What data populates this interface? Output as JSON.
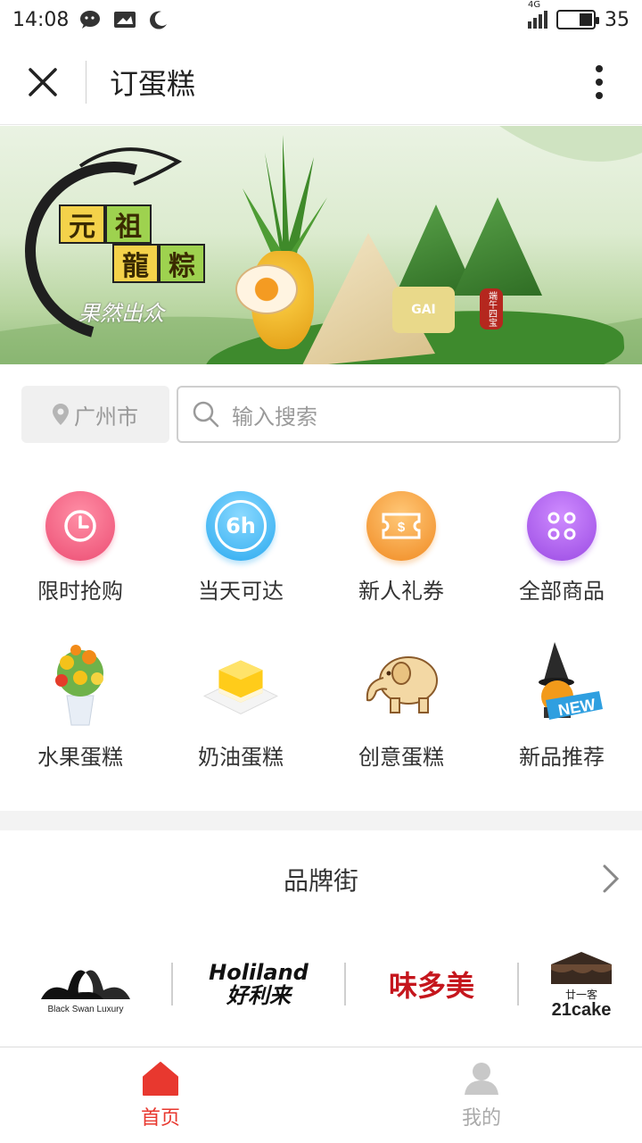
{
  "status_bar": {
    "time": "14:08",
    "network": "4G",
    "battery": "35"
  },
  "title_bar": {
    "title": "订蛋糕"
  },
  "banner": {
    "brand_chars": [
      "元",
      "祖",
      "龍",
      "粽"
    ],
    "slogan": "果然出众",
    "seal_text": "端午四宝",
    "mooncake_text": "GAI"
  },
  "location": {
    "city": "广州市",
    "search_placeholder": "输入搜索"
  },
  "categories": [
    {
      "label": "限时抢购",
      "icon": "clock-icon",
      "color": "#f2587c"
    },
    {
      "label": "当天可达",
      "icon": "6h-icon",
      "color": "#3fb7f3",
      "badge": "6h"
    },
    {
      "label": "新人礼券",
      "icon": "coupon-icon",
      "color": "#f7a03a"
    },
    {
      "label": "全部商品",
      "icon": "grid-dots-icon",
      "color": "#a65ae6"
    },
    {
      "label": "水果蛋糕",
      "icon": "fruit-cake-icon"
    },
    {
      "label": "奶油蛋糕",
      "icon": "cream-cake-icon"
    },
    {
      "label": "创意蛋糕",
      "icon": "elephant-cake-icon"
    },
    {
      "label": "新品推荐",
      "icon": "new-product-icon",
      "badge": "NEW"
    }
  ],
  "brand_street": {
    "title": "品牌街",
    "brands": [
      {
        "name": "Black Swan Luxury"
      },
      {
        "name_en": "Holiland",
        "name_cn": "好利来"
      },
      {
        "name": "味多美"
      },
      {
        "name_cn": "廿一客",
        "name_en": "21cake"
      }
    ]
  },
  "tabs": [
    {
      "label": "首页",
      "active": true
    },
    {
      "label": "我的",
      "active": false
    }
  ],
  "colors": {
    "accent": "#e8382f",
    "inactive": "#aaaaaa"
  }
}
